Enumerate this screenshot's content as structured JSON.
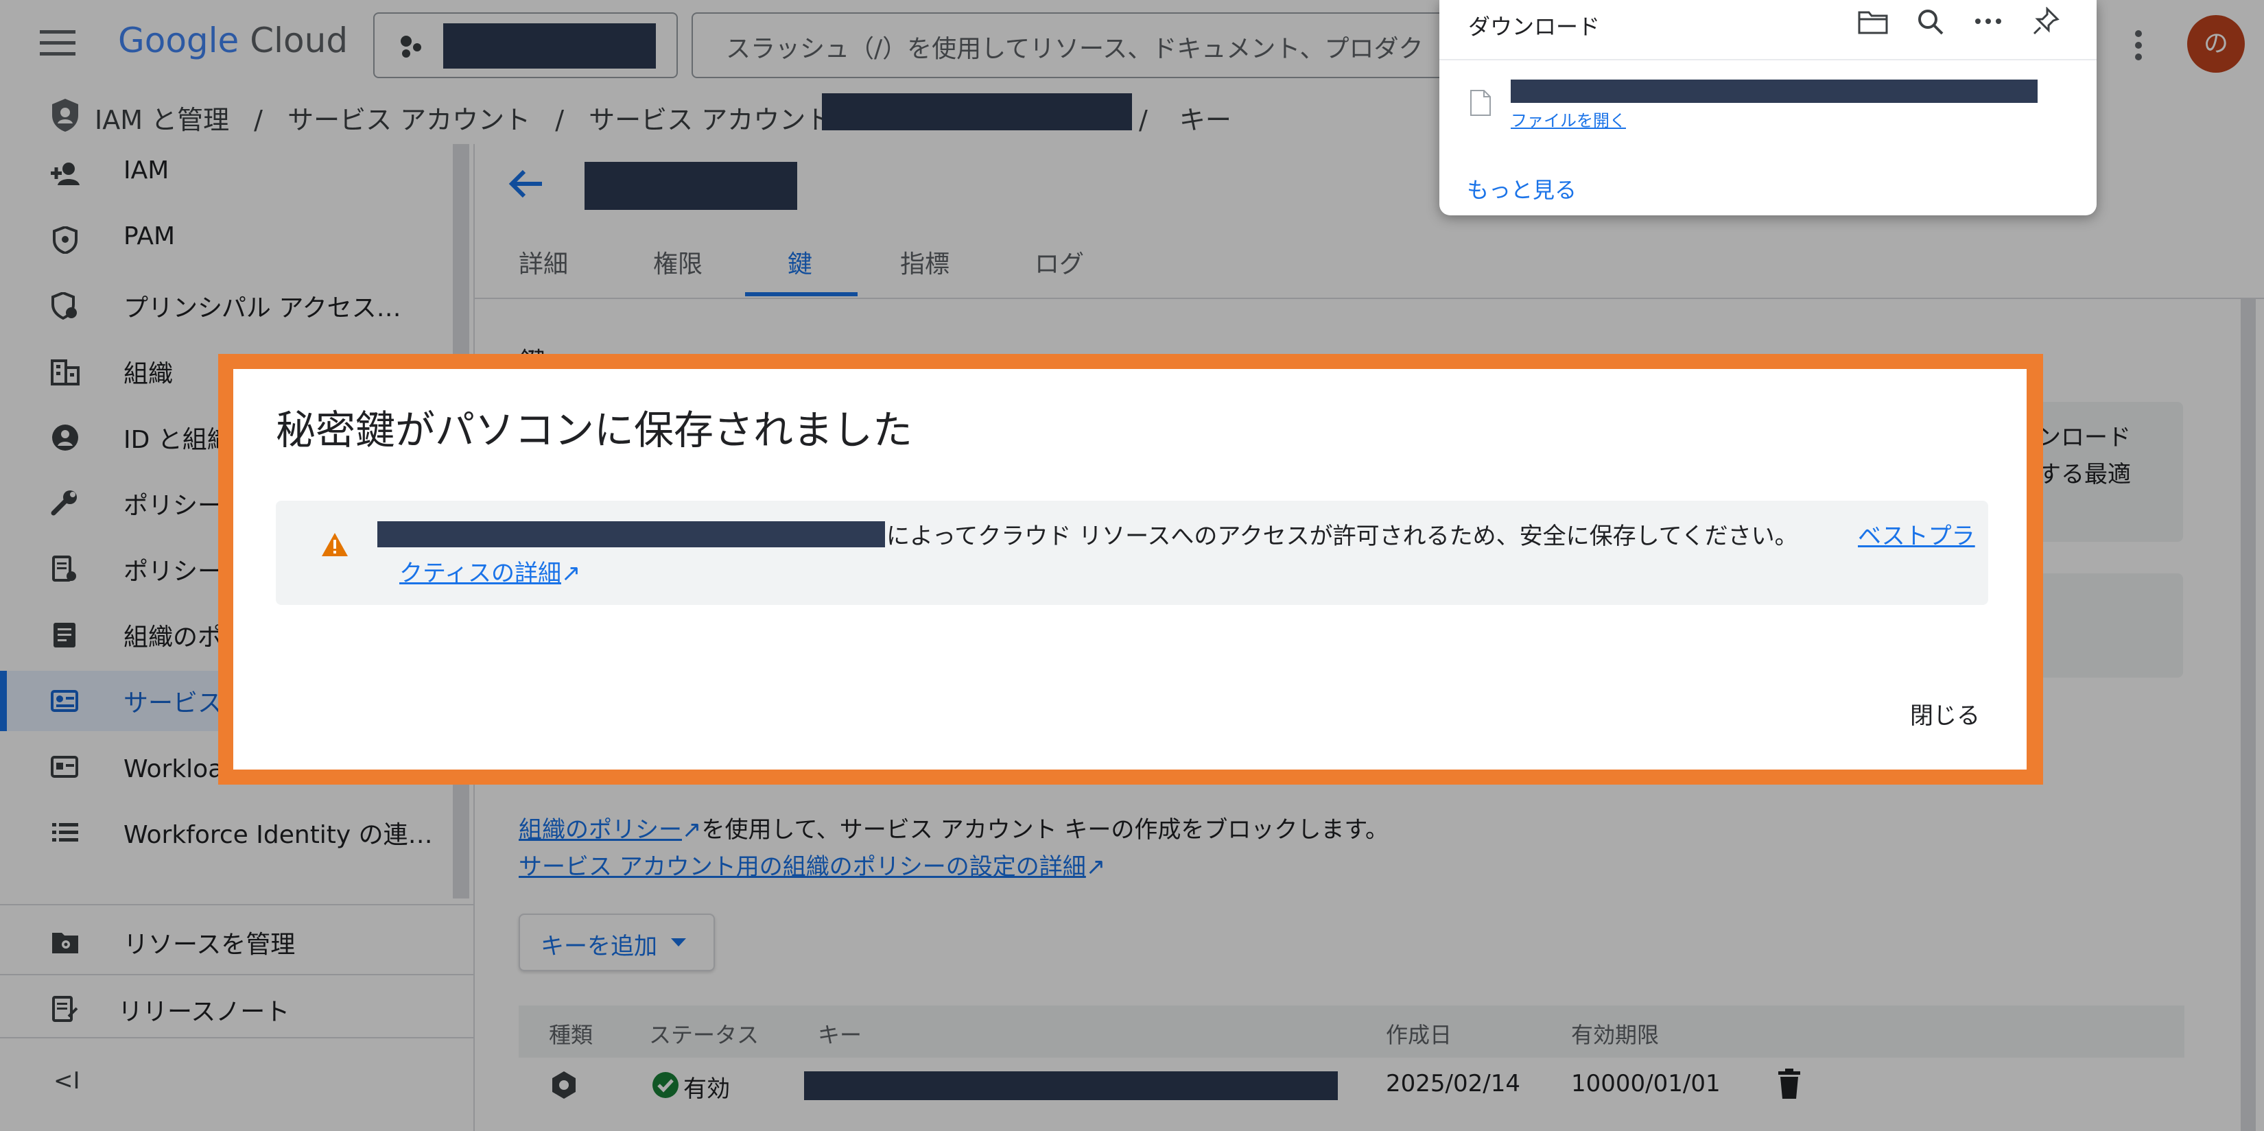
{
  "header": {
    "logo_google": "Google",
    "logo_cloud": "Cloud",
    "search_placeholder": "スラッシュ（/）を使用してリソース、ドキュメント、プロダク",
    "avatar_letter": "の"
  },
  "breadcrumb": {
    "root": "IAM と管理",
    "sep": "/",
    "level2": "サービス アカウント",
    "level3": "サービス アカウント:",
    "level4": "キー"
  },
  "sidebar": {
    "items": [
      {
        "label": "IAM",
        "icon": "person-add-icon"
      },
      {
        "label": "PAM",
        "icon": "shield-icon"
      },
      {
        "label": "プリンシパル アクセス…",
        "icon": "policy-shield-icon"
      },
      {
        "label": "組織",
        "icon": "building-icon"
      },
      {
        "label": "ID と組織",
        "icon": "account-circle-icon"
      },
      {
        "label": "ポリシー",
        "icon": "wrench-icon"
      },
      {
        "label": "ポリシー",
        "icon": "policy-document-icon"
      },
      {
        "label": "組織のポ",
        "icon": "article-icon"
      },
      {
        "label": "サービス",
        "icon": "service-account-icon"
      },
      {
        "label": "Workload Identity 連携",
        "icon": "id-card-icon"
      },
      {
        "label": "Workforce Identity の連…",
        "icon": "list-icon"
      }
    ],
    "manage_resources": "リソースを管理",
    "release_notes": "リリースノート",
    "collapse": "<I"
  },
  "main": {
    "tabs": [
      "詳細",
      "権限",
      "鍵",
      "指標",
      "ログ"
    ],
    "active_tab": 2,
    "section_title_fragment": "鍵",
    "info_fragment_1": "ンロード",
    "info_fragment_2": "する最適",
    "policy_text_link": "組織のポリシー",
    "policy_text_rest": "を使用して、サービス アカウント キーの作成をブロックします。",
    "policy_details_link": "サービス アカウント用の組織のポリシーの設定の詳細",
    "add_key_button": "キーを追加",
    "table": {
      "headers": [
        "種類",
        "ステータス",
        "キー",
        "作成日",
        "有効期限"
      ],
      "rows": [
        {
          "status": "有効",
          "created": "2025/02/14",
          "expires": "10000/01/01"
        }
      ]
    }
  },
  "dialog": {
    "title": "秘密鍵がパソコンに保存されました",
    "warning_text": "によってクラウド リソースへのアクセスが許可されるため、安全に保存してください。",
    "link_part1": "ベストプラ",
    "link_part2": "クティスの詳細",
    "close_button": "閉じる"
  },
  "downloads": {
    "title": "ダウンロード",
    "open_file": "ファイルを開く",
    "see_more": "もっと見る"
  },
  "colors": {
    "accent": "#1a73e8",
    "warning": "#e37400",
    "success": "#188038",
    "highlight_frame": "#ee7d2f"
  }
}
